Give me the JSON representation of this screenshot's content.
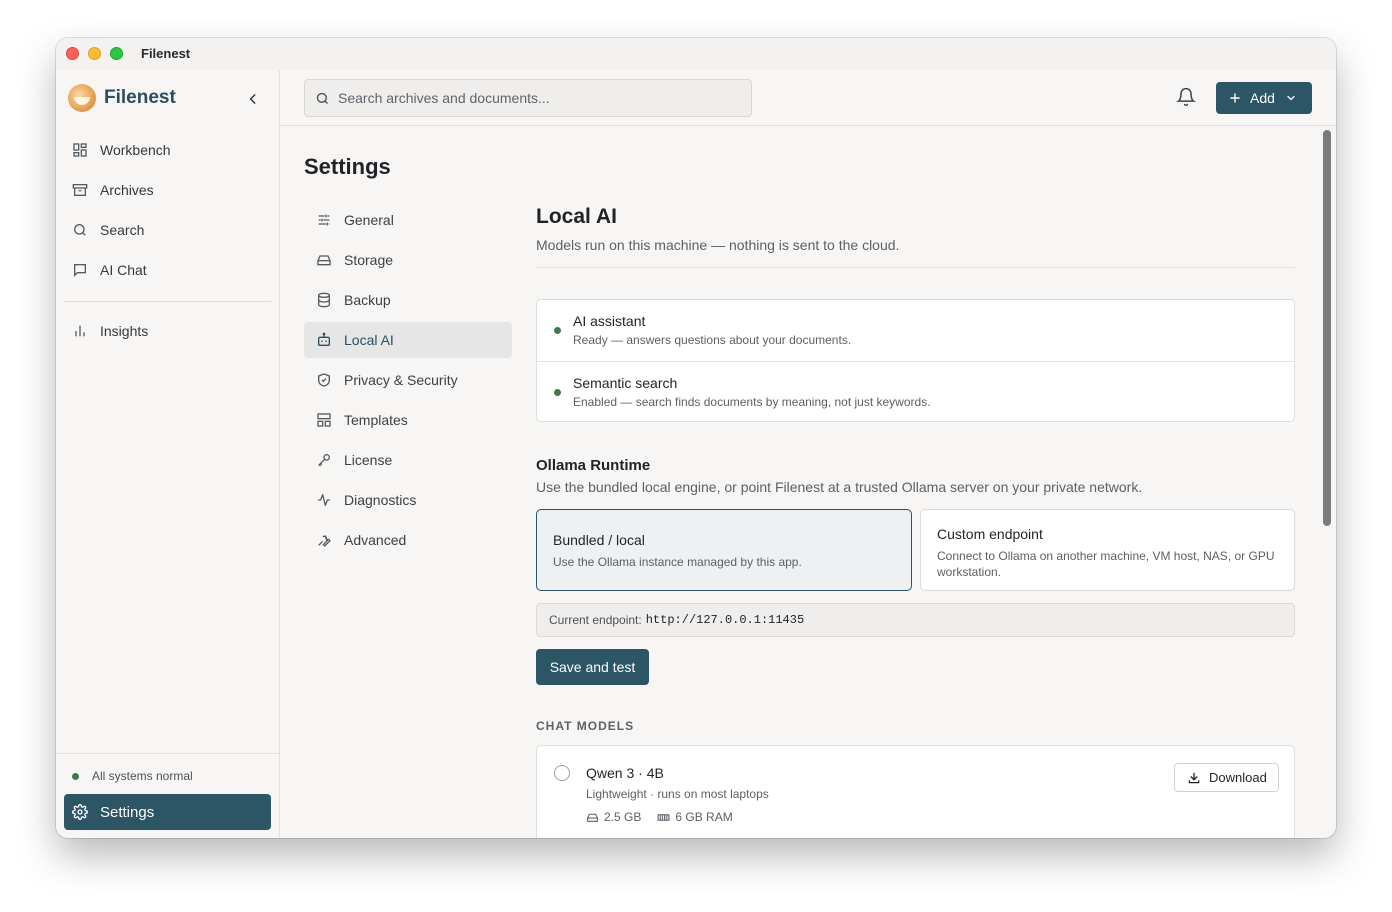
{
  "window": {
    "title": "Filenest"
  },
  "brand": {
    "name": "Filenest"
  },
  "sidebar": {
    "items": [
      {
        "label": "Workbench",
        "icon": "grid-icon"
      },
      {
        "label": "Archives",
        "icon": "archive-icon"
      },
      {
        "label": "Search",
        "icon": "search-icon"
      },
      {
        "label": "AI Chat",
        "icon": "chat-icon"
      }
    ],
    "secondary": [
      {
        "label": "Insights",
        "icon": "bar-chart-icon"
      }
    ],
    "status": "All systems normal",
    "settings_label": "Settings"
  },
  "topbar": {
    "search_placeholder": "Search archives and documents...",
    "add_label": "Add"
  },
  "settings": {
    "title": "Settings",
    "nav": [
      {
        "label": "General",
        "icon": "sliders-icon"
      },
      {
        "label": "Storage",
        "icon": "drive-icon"
      },
      {
        "label": "Backup",
        "icon": "database-icon"
      },
      {
        "label": "Local AI",
        "icon": "bot-icon",
        "active": true
      },
      {
        "label": "Privacy & Security",
        "icon": "shield-icon"
      },
      {
        "label": "Templates",
        "icon": "template-icon"
      },
      {
        "label": "License",
        "icon": "key-icon"
      },
      {
        "label": "Diagnostics",
        "icon": "activity-icon"
      },
      {
        "label": "Advanced",
        "icon": "wrench-icon"
      }
    ]
  },
  "local_ai": {
    "title": "Local AI",
    "subtitle": "Models run on this machine — nothing is sent to the cloud.",
    "status": [
      {
        "title": "AI assistant",
        "desc": "Ready — answers questions about your documents."
      },
      {
        "title": "Semantic search",
        "desc": "Enabled — search finds documents by meaning, not just keywords."
      }
    ],
    "runtime": {
      "title": "Ollama Runtime",
      "subtitle": "Use the bundled local engine, or point Filenest at a trusted Ollama server on your private network.",
      "options": [
        {
          "title": "Bundled / local",
          "desc": "Use the Ollama instance managed by this app.",
          "selected": true
        },
        {
          "title": "Custom endpoint",
          "desc": "Connect to Ollama on another machine, VM host, NAS, or GPU workstation.",
          "selected": false
        }
      ],
      "endpoint_label": "Current endpoint:",
      "endpoint_value": "http://127.0.0.1:11435",
      "save_label": "Save and test"
    },
    "models_heading": "CHAT MODELS",
    "models": [
      {
        "name": "Qwen 3 · 4B",
        "desc": "Lightweight · runs on most laptops",
        "size": "2.5 GB",
        "ram": "6 GB RAM",
        "action": "Download"
      }
    ]
  },
  "colors": {
    "accent": "#2c5566",
    "status_ok": "#3b7a4f"
  }
}
